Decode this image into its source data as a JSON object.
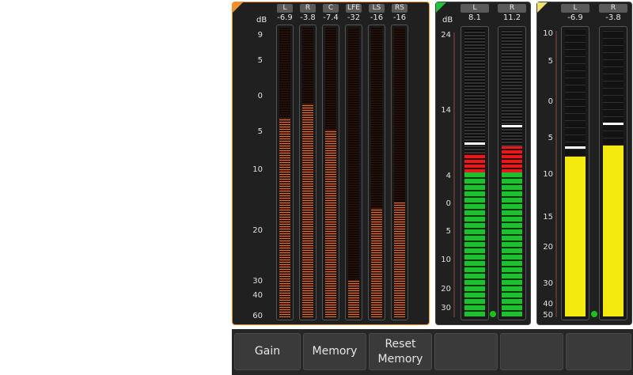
{
  "panel1": {
    "unit": "dB",
    "accent": "#f0902a",
    "channels": [
      {
        "label": "L",
        "value": "-6.9",
        "level": 0.69
      },
      {
        "label": "R",
        "value": "-3.8",
        "level": 0.74
      },
      {
        "label": "C",
        "value": "-7.4",
        "level": 0.65
      },
      {
        "label": "LFE",
        "value": "-32",
        "level": 0.13
      },
      {
        "label": "LS",
        "value": "-16",
        "level": 0.38
      },
      {
        "label": "RS",
        "value": "-16",
        "level": 0.4
      }
    ],
    "ticks": [
      "9",
      "5",
      "0",
      "5",
      "10",
      "20",
      "30",
      "40",
      "60"
    ]
  },
  "panel2": {
    "unit": "dB",
    "accent": "#1fc23a",
    "channels": [
      {
        "label": "L",
        "value": "8.1",
        "green": 1.0,
        "red": 0.13,
        "peak": 0.6
      },
      {
        "label": "R",
        "value": "11.2",
        "green": 1.0,
        "red": 0.2,
        "peak": 0.66
      }
    ],
    "ticks": [
      "24",
      "14",
      "4",
      "0",
      "5",
      "10",
      "20",
      "30"
    ]
  },
  "panel3": {
    "accent": "#f0e070",
    "channels": [
      {
        "label": "L",
        "value": "-6.9",
        "level": 0.56,
        "peak": 0.57
      },
      {
        "label": "R",
        "value": "-3.8",
        "level": 0.6,
        "peak": 0.65
      }
    ],
    "ticks": [
      "10",
      "5",
      "0",
      "5",
      "10",
      "15",
      "20",
      "30",
      "40",
      "50"
    ]
  },
  "buttons": [
    {
      "label": "Gain"
    },
    {
      "label": "Memory"
    },
    {
      "label": "Reset\nMemory"
    },
    {
      "label": ""
    },
    {
      "label": ""
    },
    {
      "label": ""
    }
  ]
}
